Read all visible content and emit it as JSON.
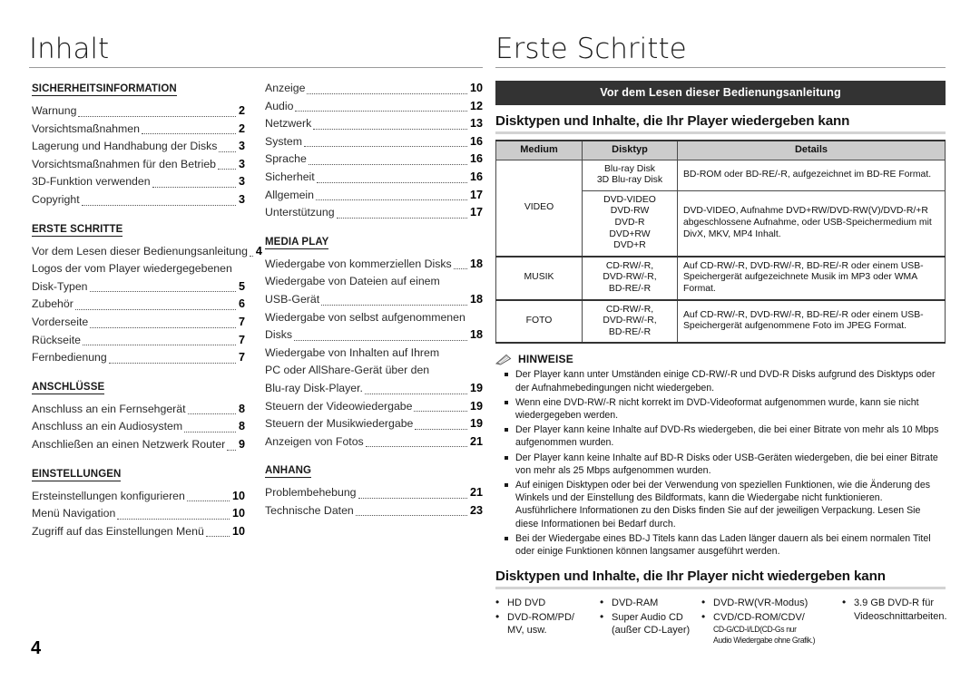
{
  "page": {
    "number": "4"
  },
  "left_page": {
    "title": "Inhalt",
    "column1": [
      {
        "heading": "SICHERHEITSINFORMATION",
        "entries": [
          {
            "label": "Warnung",
            "page": "2",
            "dots": true
          },
          {
            "label": "Vorsichtsmaßnahmen",
            "page": "2",
            "dots": true
          },
          {
            "label": "Lagerung und Handhabung der Disks",
            "page": "3",
            "dots": true
          },
          {
            "label": "Vorsichtsmaßnahmen für den Betrieb",
            "page": "3",
            "dots": true
          },
          {
            "label": "3D-Funktion verwenden",
            "page": "3",
            "dots": true
          },
          {
            "label": "Copyright",
            "page": "3",
            "dots": true
          }
        ]
      },
      {
        "heading": "ERSTE SCHRITTE",
        "entries": [
          {
            "label": "Vor dem Lesen dieser Bedienungsanleitung",
            "page": "4",
            "dots": true
          },
          {
            "label": "Logos der vom Player wiedergegebenen",
            "page": "",
            "dots": false
          },
          {
            "label": "Disk-Typen",
            "page": "5",
            "dots": true
          },
          {
            "label": "Zubehör",
            "page": "6",
            "dots": true
          },
          {
            "label": "Vorderseite",
            "page": "7",
            "dots": true
          },
          {
            "label": "Rückseite",
            "page": "7",
            "dots": true
          },
          {
            "label": "Fernbedienung",
            "page": "7",
            "dots": true
          }
        ]
      },
      {
        "heading": "ANSCHLÜSSE",
        "entries": [
          {
            "label": "Anschluss an ein Fernsehgerät",
            "page": "8",
            "dots": true
          },
          {
            "label": "Anschluss an ein Audiosystem",
            "page": "8",
            "dots": true
          },
          {
            "label": "Anschließen an einen Netzwerk Router",
            "page": "9",
            "dots": true
          }
        ]
      },
      {
        "heading": "EINSTELLUNGEN",
        "entries": [
          {
            "label": "Ersteinstellungen konfigurieren",
            "page": "10",
            "dots": true
          },
          {
            "label": "Menü Navigation",
            "page": "10",
            "dots": true
          },
          {
            "label": "Zugriff auf das Einstellungen Menü",
            "page": "10",
            "dots": true
          }
        ]
      }
    ],
    "column2": [
      {
        "heading": "",
        "entries": [
          {
            "label": "Anzeige",
            "page": "10",
            "dots": true
          },
          {
            "label": "Audio",
            "page": "12",
            "dots": true
          },
          {
            "label": "Netzwerk",
            "page": "13",
            "dots": true
          },
          {
            "label": "System",
            "page": "16",
            "dots": true
          },
          {
            "label": "Sprache",
            "page": "16",
            "dots": true
          },
          {
            "label": "Sicherheit",
            "page": "16",
            "dots": true
          },
          {
            "label": "Allgemein",
            "page": "17",
            "dots": true
          },
          {
            "label": "Unterstützung",
            "page": "17",
            "dots": true
          }
        ]
      },
      {
        "heading": "MEDIA PLAY",
        "entries": [
          {
            "label": "Wiedergabe von kommerziellen Disks",
            "page": "18",
            "dots": true
          },
          {
            "label": "Wiedergabe von Dateien auf einem",
            "page": "",
            "dots": false
          },
          {
            "label": "USB-Gerät",
            "page": "18",
            "dots": true
          },
          {
            "label": "Wiedergabe von selbst aufgenommenen",
            "page": "",
            "dots": false
          },
          {
            "label": "Disks",
            "page": "18",
            "dots": true
          },
          {
            "label": "Wiedergabe von Inhalten auf Ihrem",
            "page": "",
            "dots": false
          },
          {
            "label": "PC oder AllShare-Gerät über den",
            "page": "",
            "dots": false
          },
          {
            "label": "Blu-ray Disk-Player.",
            "page": "19",
            "dots": true
          },
          {
            "label": "Steuern der Videowiedergabe",
            "page": "19",
            "dots": true
          },
          {
            "label": "Steuern der Musikwiedergabe",
            "page": "19",
            "dots": true
          },
          {
            "label": "Anzeigen von Fotos",
            "page": "21",
            "dots": true
          }
        ]
      },
      {
        "heading": "ANHANG",
        "entries": [
          {
            "label": "Problembehebung",
            "page": "21",
            "dots": true
          },
          {
            "label": "Technische Daten",
            "page": "23",
            "dots": true
          }
        ]
      }
    ]
  },
  "right_page": {
    "title": "Erste Schritte",
    "banner": "Vor dem Lesen dieser Bedienungsanleitung",
    "playable_heading": "Disktypen und Inhalte, die Ihr Player wiedergeben kann",
    "table": {
      "headers": [
        "Medium",
        "Disktyp",
        "Details"
      ],
      "rows": [
        {
          "medium": "VIDEO",
          "medium_rowspan": 2,
          "disktyp": "Blu-ray Disk\n3D Blu-ray Disk",
          "details": "BD-ROM oder BD-RE/-R, aufgezeichnet im BD-RE Format."
        },
        {
          "medium": "",
          "disktyp": "DVD-VIDEO\nDVD-RW\nDVD-R\nDVD+RW\nDVD+R",
          "details": "DVD-VIDEO, Aufnahme DVD+RW/DVD-RW(V)/DVD-R/+R abgeschlossene Aufnahme, oder USB-Speichermedium mit DivX, MKV, MP4 Inhalt."
        },
        {
          "medium": "MUSIK",
          "disktyp": "CD-RW/-R,\nDVD-RW/-R,\nBD-RE/-R",
          "details": "Auf CD-RW/-R, DVD-RW/-R, BD-RE/-R oder einem USB-Speichergerät aufgezeichnete Musik im MP3 oder WMA Format."
        },
        {
          "medium": "FOTO",
          "disktyp": "CD-RW/-R,\nDVD-RW/-R,\nBD-RE/-R",
          "details": "Auf CD-RW/-R, DVD-RW/-R, BD-RE/-R oder einem USB-Speichergerät aufgenommene Foto im JPEG Format."
        }
      ]
    },
    "notes": {
      "icon": "pencil-icon",
      "title": "HINWEISE",
      "items": [
        "Der Player kann unter Umständen einige CD-RW/-R und DVD-R Disks aufgrund des Disktyps oder der Aufnahmebedingungen nicht wiedergeben.",
        "Wenn eine DVD-RW/-R nicht korrekt im DVD-Videoformat aufgenommen wurde, kann sie nicht wiedergegeben werden.",
        "Der Player kann keine Inhalte auf DVD-Rs wiedergeben, die bei einer Bitrate von mehr als 10 Mbps aufgenommen wurden.",
        "Der Player kann keine Inhalte auf BD-R Disks oder USB-Geräten wiedergeben, die bei einer Bitrate von mehr als 25 Mbps aufgenommen wurden.",
        "Auf einigen Disktypen oder bei der Verwendung von speziellen Funktionen, wie die Änderung des Winkels und der Einstellung des Bildformats, kann die Wiedergabe nicht funktionieren. Ausführlichere Informationen zu den Disks finden Sie auf der jeweiligen Verpackung. Lesen Sie diese Informationen bei Bedarf durch.",
        "Bei der Wiedergabe eines BD-J Titels kann das Laden länger dauern als bei einem normalen Titel oder einige Funktionen können langsamer ausgeführt werden."
      ]
    },
    "nonplayable_heading": "Disktypen und Inhalte, die Ihr Player nicht wiedergeben kann",
    "nonplayable_columns": [
      {
        "items": [
          {
            "text": "HD DVD",
            "small": ""
          },
          {
            "text": "DVD-ROM/PD/",
            "sub": "MV, usw.",
            "small": ""
          }
        ]
      },
      {
        "items": [
          {
            "text": "DVD-RAM",
            "small": ""
          },
          {
            "text": "Super Audio CD",
            "sub": "(außer CD-Layer)",
            "small": ""
          }
        ]
      },
      {
        "items": [
          {
            "text": "DVD-RW(VR-Modus)",
            "small": ""
          },
          {
            "text": "CVD/CD-ROM/CDV/",
            "small": "CD-G/CD-I/LD(CD-Gs nur\nAudio Wiedergabe ohne Grafik.)"
          }
        ]
      },
      {
        "items": [
          {
            "text": "3.9 GB DVD-R für",
            "sub": "Videoschnittarbeiten.",
            "small": ""
          }
        ]
      }
    ]
  },
  "colors": {
    "banner_bg": "#333333",
    "table_header_bg": "#cccccc",
    "rule_gray": "#d3d3d3",
    "text": "#111111"
  }
}
